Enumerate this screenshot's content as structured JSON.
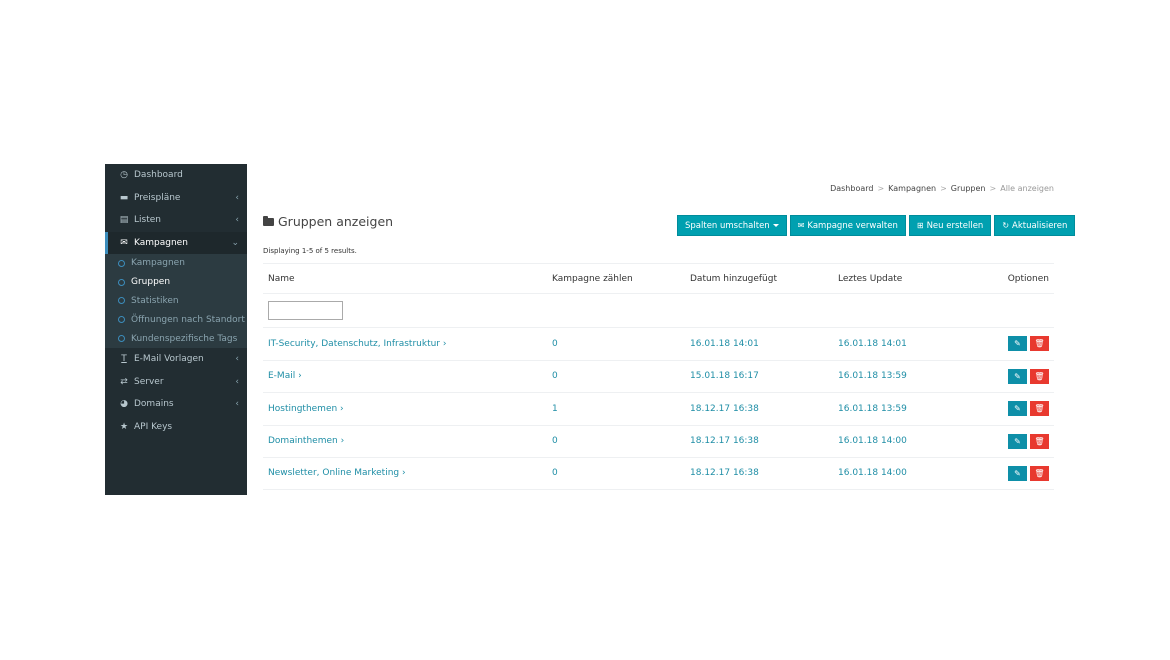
{
  "sidebar": {
    "items": [
      {
        "label": "Dashboard",
        "icon": "dashboard-icon",
        "glyph": "◷",
        "chevron": ""
      },
      {
        "label": "Preispläne",
        "icon": "credit-card-icon",
        "glyph": "▬",
        "chevron": "‹"
      },
      {
        "label": "Listen",
        "icon": "list-icon",
        "glyph": "▤",
        "chevron": "‹"
      },
      {
        "label": "Kampagnen",
        "icon": "envelope-icon",
        "glyph": "✉",
        "chevron": "⌄"
      }
    ],
    "subitems": [
      {
        "label": "Kampagnen"
      },
      {
        "label": "Gruppen"
      },
      {
        "label": "Statistiken"
      },
      {
        "label": "Öffnungen nach Standort"
      },
      {
        "label": "Kundenspezifische Tags"
      }
    ],
    "items_after": [
      {
        "label": "E-Mail Vorlagen",
        "icon": "text-icon",
        "glyph": "T",
        "chevron": "‹"
      },
      {
        "label": "Server",
        "icon": "exchange-icon",
        "glyph": "⇄",
        "chevron": "‹"
      },
      {
        "label": "Domains",
        "icon": "globe-icon",
        "glyph": "◕",
        "chevron": "‹"
      },
      {
        "label": "API Keys",
        "icon": "star-icon",
        "glyph": "★",
        "chevron": ""
      }
    ]
  },
  "breadcrumb": {
    "items": [
      "Dashboard",
      "Kampagnen",
      "Gruppen"
    ],
    "current": "Alle anzeigen",
    "separator": ">"
  },
  "page": {
    "title": "Gruppen anzeigen",
    "summary": "Displaying 1-5 of 5 results."
  },
  "toolbar": {
    "columns_label": "Spalten umschalten",
    "manage_label": "Kampagne verwalten",
    "new_label": "Neu erstellen",
    "refresh_label": "Aktualisieren"
  },
  "table": {
    "headers": {
      "name": "Name",
      "count": "Kampagne zählen",
      "date_added": "Datum hinzugefügt",
      "last_update": "Leztes Update",
      "options": "Optionen"
    },
    "filter_value": "",
    "rows": [
      {
        "name": "IT-Security, Datenschutz, Infrastruktur ›",
        "count": "0",
        "date_added": "16.01.18 14:01",
        "last_update": "16.01.18 14:01"
      },
      {
        "name": "E-Mail ›",
        "count": "0",
        "date_added": "15.01.18 16:17",
        "last_update": "16.01.18 13:59"
      },
      {
        "name": "Hostingthemen ›",
        "count": "1",
        "date_added": "18.12.17 16:38",
        "last_update": "16.01.18 13:59"
      },
      {
        "name": "Domainthemen ›",
        "count": "0",
        "date_added": "18.12.17 16:38",
        "last_update": "16.01.18 14:00"
      },
      {
        "name": "Newsletter, Online Marketing ›",
        "count": "0",
        "date_added": "18.12.17 16:38",
        "last_update": "16.01.18 14:00"
      }
    ]
  },
  "colors": {
    "sidebar_bg": "#222d32",
    "accent": "#00a0b0",
    "link": "#1f8ea6",
    "danger": "#e8392f"
  }
}
